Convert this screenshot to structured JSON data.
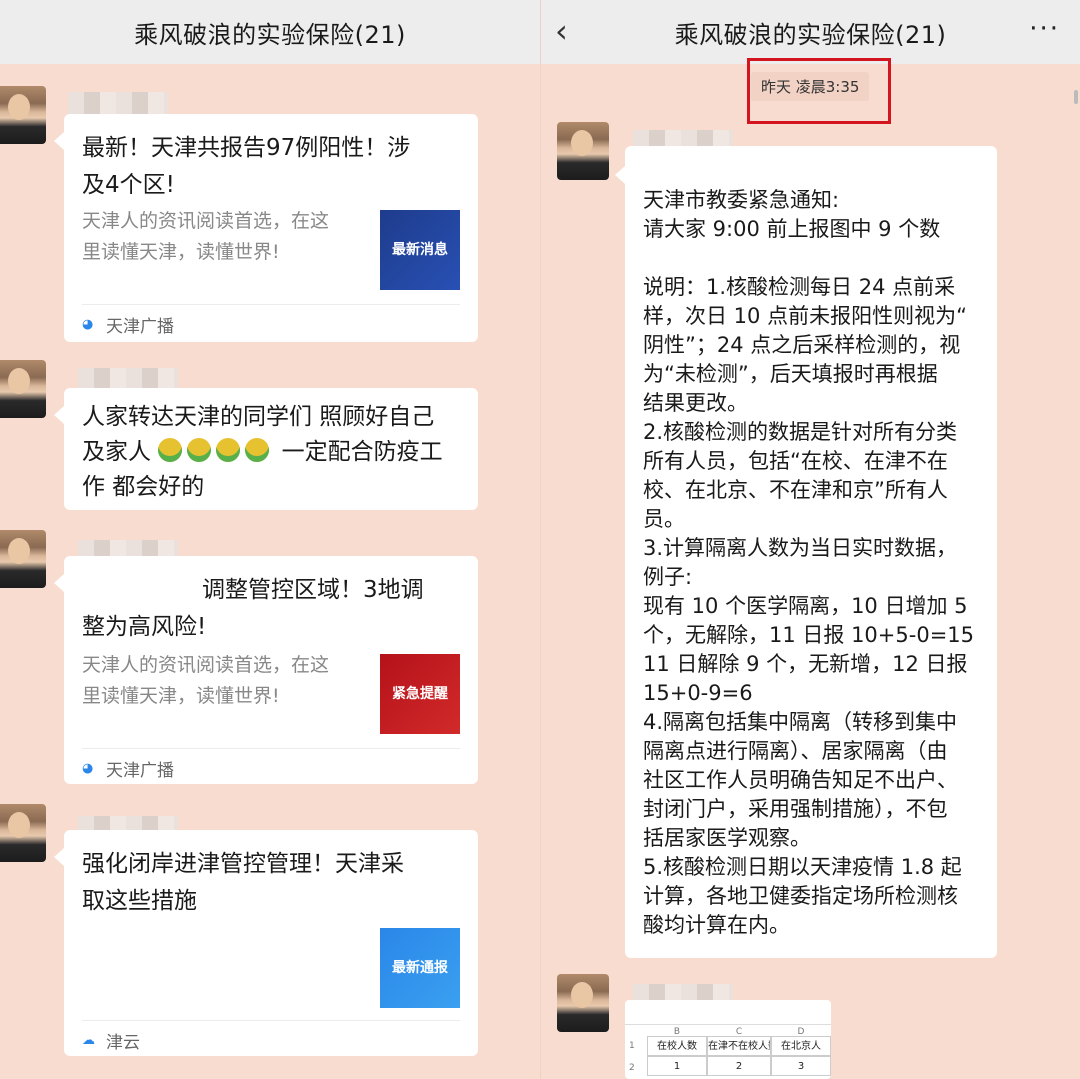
{
  "left": {
    "title": "乘风破浪的实验保险(21)",
    "back_icon": "chevron-left-icon",
    "messages": [
      {
        "title_l1": "最新！天津共报告97例阳性！涉",
        "title_l2": "及4个区!",
        "desc_l1": "天津人的资讯阅读首选，在这",
        "desc_l2": "里读懂天津，读懂世界!",
        "thumb_text": "最新消息",
        "source": "天津广播"
      },
      {
        "text_l1": "人家转达天津的同学们 照顾好自己",
        "text_l2_a": "及家人",
        "text_l2_b": "一定配合防疫工",
        "text_l3": "作 都会好的"
      },
      {
        "title_l1": "调整管控区域！3地调",
        "title_l2": "整为高风险!",
        "desc_l1": "天津人的资讯阅读首选，在这",
        "desc_l2": "里读懂天津，读懂世界!",
        "thumb_text": "紧急提醒",
        "source": "天津广播"
      },
      {
        "title_l1": "强化闭岸进津管控管理！天津采",
        "title_l2": "取这些措施",
        "thumb_text": "最新通报",
        "source": "津云"
      }
    ]
  },
  "right": {
    "title": "乘风破浪的实验保险(21)",
    "more_label": "···",
    "timestamp": "昨天 凌晨3:35",
    "notice_lines": [
      "天津市教委紧急通知:",
      "请大家 9:00 前上报图中 9 个数",
      "",
      "说明：1.核酸检测每日 24 点前采",
      "样，次日 10 点前未报阳性则视为“",
      "阴性”；24 点之后采样检测的，视",
      "为“未检测”，后天填报时再根据",
      "结果更改。",
      "2.核酸检测的数据是针对所有分类",
      "所有人员，包括“在校、在津不在",
      "校、在北京、不在津和京”所有人",
      "员。",
      "3.计算隔离人数为当日实时数据，",
      "例子:",
      "现有 10 个医学隔离，10 日增加 5",
      "个，无解除，11 日报 10+5-0=15",
      "11 日解除 9 个，无新增，12 日报",
      "15+0-9=6",
      "4.隔离包括集中隔离（转移到集中",
      "隔离点进行隔离）、居家隔离（由",
      "社区工作人员明确告知足不出户、",
      "封闭门户，采用强制措施），不包",
      "括居家医学观察。",
      "5.核酸检测日期以天津疫情 1.8 起",
      "计算，各地卫健委指定场所检测核",
      "酸均计算在内。"
    ],
    "sheet": {
      "col_letters": [
        "B",
        "C",
        "D"
      ],
      "header": [
        "在校人数",
        "在津不在校人数",
        "在北京人"
      ],
      "row": [
        "1",
        "2",
        "3"
      ],
      "row_nums": [
        "1",
        "2"
      ]
    }
  }
}
